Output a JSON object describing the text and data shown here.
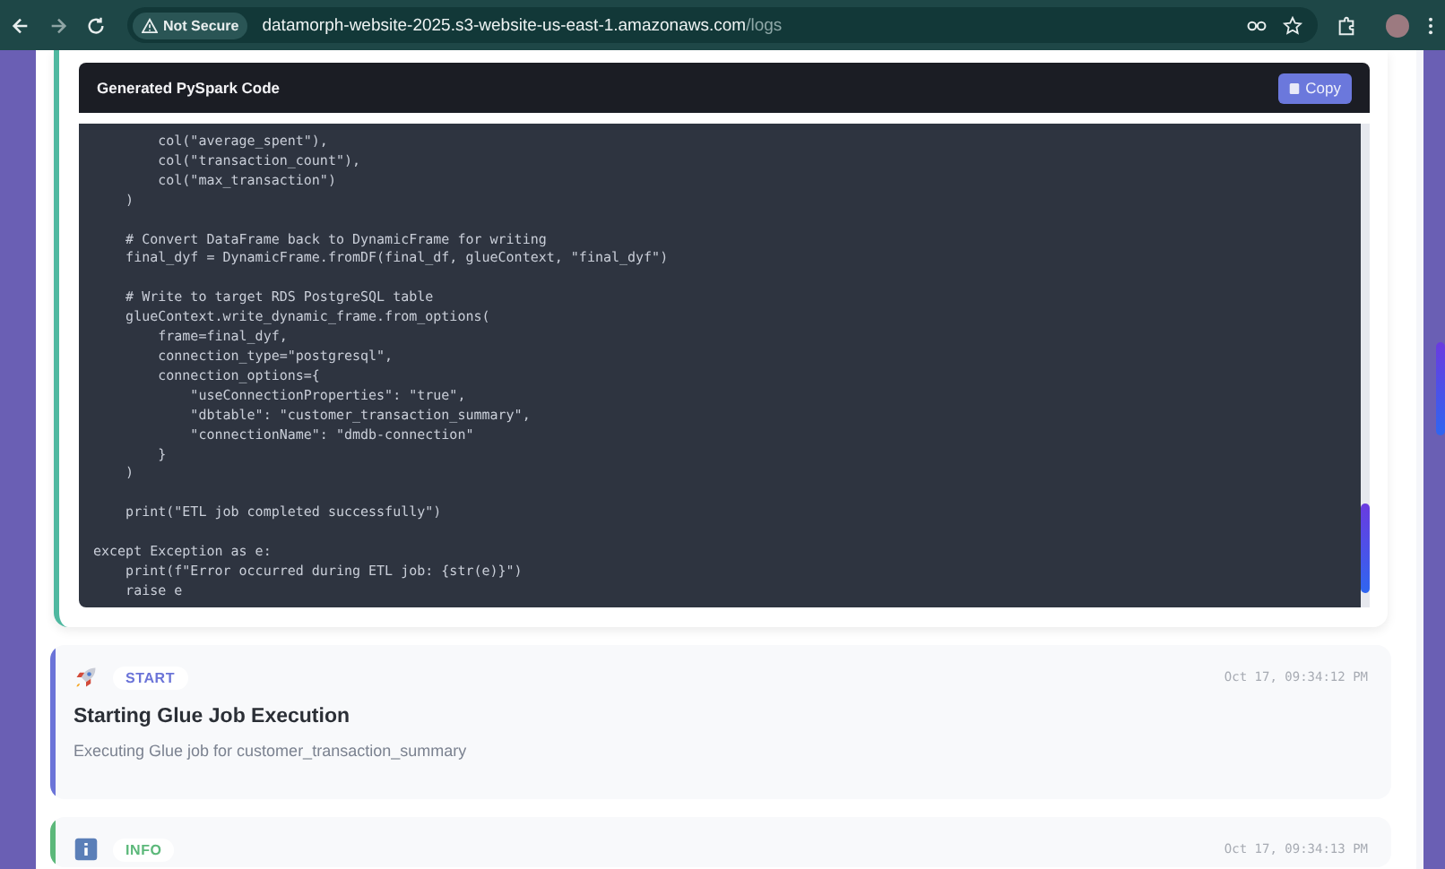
{
  "browser": {
    "security_label": "Not Secure",
    "url_host": "datamorph-website-2025.s3-website-us-east-1.amazonaws.com",
    "url_path": "/logs"
  },
  "code_panel": {
    "title": "Generated PySpark Code",
    "copy_button": "Copy",
    "code": "        col(\"average_spent\"),\n        col(\"transaction_count\"),\n        col(\"max_transaction\")\n    )\n\n    # Convert DataFrame back to DynamicFrame for writing\n    final_dyf = DynamicFrame.fromDF(final_df, glueContext, \"final_dyf\")\n\n    # Write to target RDS PostgreSQL table\n    glueContext.write_dynamic_frame.from_options(\n        frame=final_dyf,\n        connection_type=\"postgresql\",\n        connection_options={\n            \"useConnectionProperties\": \"true\",\n            \"dbtable\": \"customer_transaction_summary\",\n            \"connectionName\": \"dmdb-connection\"\n        }\n    )\n\n    print(\"ETL job completed successfully\")\n\nexcept Exception as e:\n    print(f\"Error occurred during ETL job: {str(e)}\")\n    raise e"
  },
  "log_entries": [
    {
      "kind": "start",
      "badge": "START",
      "timestamp": "Oct 17, 09:34:12 PM",
      "title": "Starting Glue Job Execution",
      "message": "Executing Glue job for customer_transaction_summary",
      "color": "#6b74d8"
    },
    {
      "kind": "info",
      "badge": "INFO",
      "timestamp": "Oct 17, 09:34:13 PM",
      "color": "#5cb87a"
    }
  ]
}
